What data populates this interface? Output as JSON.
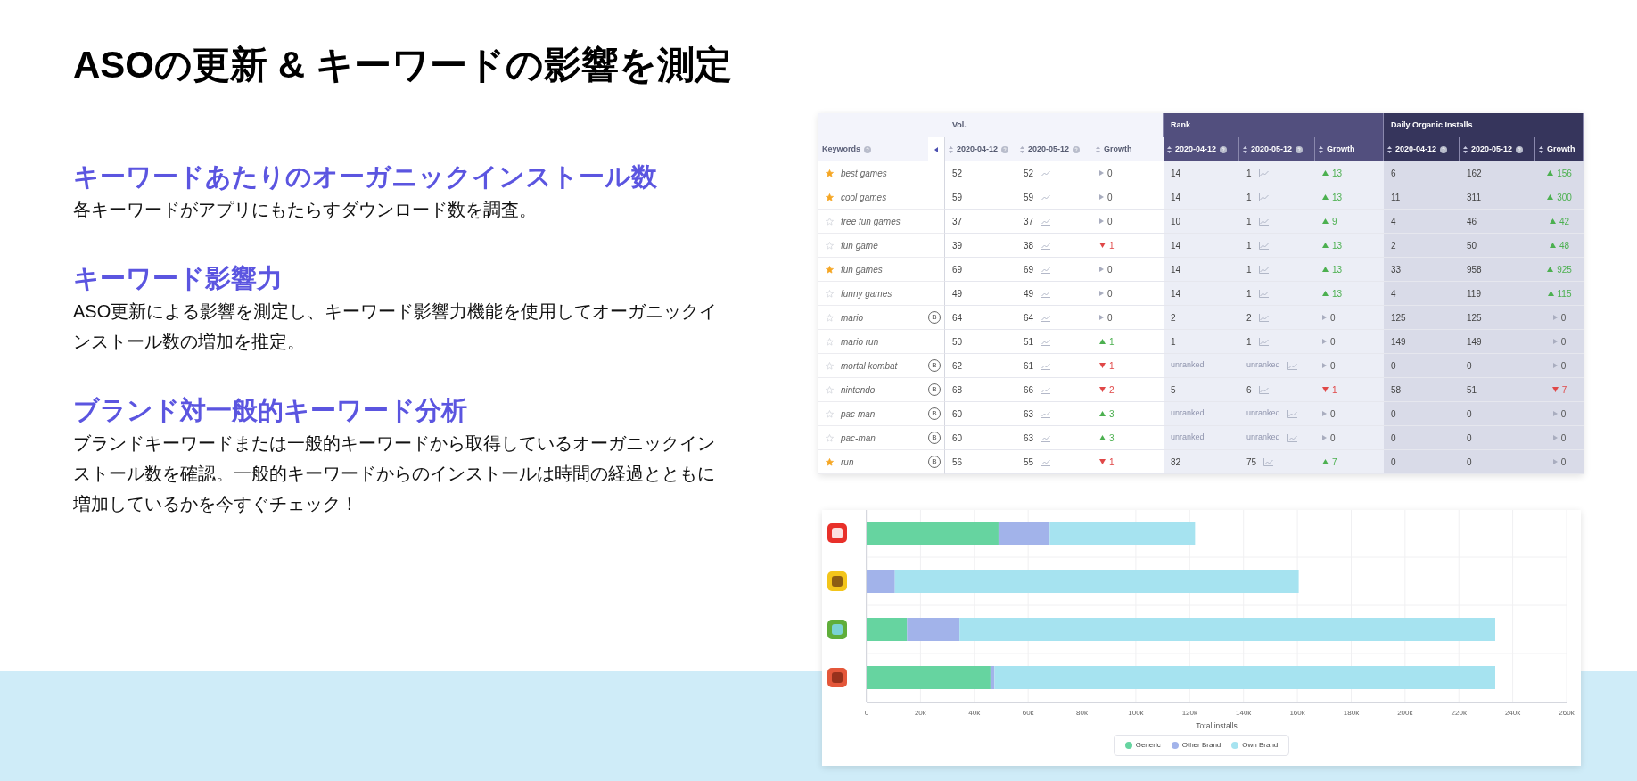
{
  "heading": "ASOの更新 & キーワードの影響を測定",
  "features": [
    {
      "title": "キーワードあたりのオーガニックインストール数",
      "text": "各キーワードがアプリにもたらすダウンロード数を調査。"
    },
    {
      "title": "キーワード影響力",
      "text": "ASO更新による影響を測定し、キーワード影響力機能を使用してオーガニックインストール数の増加を推定。"
    },
    {
      "title": "ブランド対一般的キーワード分析",
      "text": "ブランドキーワードまたは一般的キーワードから取得しているオーガニックインストール数を確認。一般的キーワードからのインストールは時間の経過とともに増加しているかを今すぐチェック！"
    }
  ],
  "table": {
    "keywords_header": "Keywords",
    "groups": [
      "Vol.",
      "Rank",
      "Daily Organic Installs"
    ],
    "columns": [
      "2020-04-12",
      "2020-05-12",
      "Growth",
      "2020-04-12",
      "2020-05-12",
      "Growth",
      "2020-04-12",
      "2020-05-12",
      "Growth"
    ],
    "rows": [
      {
        "keyword": "best games",
        "starred": true,
        "vol": [
          "52",
          "52"
        ],
        "vol_growth": {
          "kind": "flat",
          "value": "0"
        },
        "rank": [
          {
            "text": "14",
            "muted": false
          },
          {
            "text": "1",
            "muted": false
          }
        ],
        "rank_growth": {
          "kind": "up",
          "value": "13"
        },
        "installs": [
          "6",
          "162"
        ],
        "installs_growth": {
          "kind": "up",
          "value": "156"
        }
      },
      {
        "keyword": "cool games",
        "starred": true,
        "vol": [
          "59",
          "59"
        ],
        "vol_growth": {
          "kind": "flat",
          "value": "0"
        },
        "rank": [
          {
            "text": "14",
            "muted": false
          },
          {
            "text": "1",
            "muted": false
          }
        ],
        "rank_growth": {
          "kind": "up",
          "value": "13"
        },
        "installs": [
          "11",
          "311"
        ],
        "installs_growth": {
          "kind": "up",
          "value": "300"
        }
      },
      {
        "keyword": "free fun games",
        "starred": false,
        "vol": [
          "37",
          "37"
        ],
        "vol_growth": {
          "kind": "flat",
          "value": "0"
        },
        "rank": [
          {
            "text": "10",
            "muted": false
          },
          {
            "text": "1",
            "muted": false
          }
        ],
        "rank_growth": {
          "kind": "up",
          "value": "9"
        },
        "installs": [
          "4",
          "46"
        ],
        "installs_growth": {
          "kind": "up",
          "value": "42"
        }
      },
      {
        "keyword": "fun game",
        "starred": false,
        "vol": [
          "39",
          "38"
        ],
        "vol_growth": {
          "kind": "down",
          "value": "1"
        },
        "rank": [
          {
            "text": "14",
            "muted": false
          },
          {
            "text": "1",
            "muted": false
          }
        ],
        "rank_growth": {
          "kind": "up",
          "value": "13"
        },
        "installs": [
          "2",
          "50"
        ],
        "installs_growth": {
          "kind": "up",
          "value": "48"
        }
      },
      {
        "keyword": "fun games",
        "starred": true,
        "vol": [
          "69",
          "69"
        ],
        "vol_growth": {
          "kind": "flat",
          "value": "0"
        },
        "rank": [
          {
            "text": "14",
            "muted": false
          },
          {
            "text": "1",
            "muted": false
          }
        ],
        "rank_growth": {
          "kind": "up",
          "value": "13"
        },
        "installs": [
          "33",
          "958"
        ],
        "installs_growth": {
          "kind": "up",
          "value": "925"
        }
      },
      {
        "keyword": "funny games",
        "starred": false,
        "vol": [
          "49",
          "49"
        ],
        "vol_growth": {
          "kind": "flat",
          "value": "0"
        },
        "rank": [
          {
            "text": "14",
            "muted": false
          },
          {
            "text": "1",
            "muted": false
          }
        ],
        "rank_growth": {
          "kind": "up",
          "value": "13"
        },
        "installs": [
          "4",
          "119"
        ],
        "installs_growth": {
          "kind": "up",
          "value": "115"
        }
      },
      {
        "keyword": "mario",
        "starred": false,
        "brand": "B",
        "vol": [
          "64",
          "64"
        ],
        "vol_growth": {
          "kind": "flat",
          "value": "0"
        },
        "rank": [
          {
            "text": "2",
            "muted": false
          },
          {
            "text": "2",
            "muted": false
          }
        ],
        "rank_growth": {
          "kind": "flat",
          "value": "0"
        },
        "installs": [
          "125",
          "125"
        ],
        "installs_growth": {
          "kind": "flat",
          "value": "0"
        }
      },
      {
        "keyword": "mario run",
        "starred": false,
        "vol": [
          "50",
          "51"
        ],
        "vol_growth": {
          "kind": "up",
          "value": "1"
        },
        "rank": [
          {
            "text": "1",
            "muted": false
          },
          {
            "text": "1",
            "muted": false
          }
        ],
        "rank_growth": {
          "kind": "flat",
          "value": "0"
        },
        "installs": [
          "149",
          "149"
        ],
        "installs_growth": {
          "kind": "flat",
          "value": "0"
        }
      },
      {
        "keyword": "mortal kombat",
        "starred": false,
        "brand": "B",
        "vol": [
          "62",
          "61"
        ],
        "vol_growth": {
          "kind": "down",
          "value": "1"
        },
        "rank": [
          {
            "text": "unranked",
            "muted": true
          },
          {
            "text": "unranked",
            "muted": true
          }
        ],
        "rank_growth": {
          "kind": "flat",
          "value": "0"
        },
        "installs": [
          "0",
          "0"
        ],
        "installs_growth": {
          "kind": "flat",
          "value": "0"
        }
      },
      {
        "keyword": "nintendo",
        "starred": false,
        "brand": "B",
        "vol": [
          "68",
          "66"
        ],
        "vol_growth": {
          "kind": "down",
          "value": "2"
        },
        "rank": [
          {
            "text": "5",
            "muted": false
          },
          {
            "text": "6",
            "muted": false
          }
        ],
        "rank_growth": {
          "kind": "down",
          "value": "1"
        },
        "installs": [
          "58",
          "51"
        ],
        "installs_growth": {
          "kind": "down",
          "value": "7"
        }
      },
      {
        "keyword": "pac man",
        "starred": false,
        "brand": "B",
        "vol": [
          "60",
          "63"
        ],
        "vol_growth": {
          "kind": "up",
          "value": "3"
        },
        "rank": [
          {
            "text": "unranked",
            "muted": true
          },
          {
            "text": "unranked",
            "muted": true
          }
        ],
        "rank_growth": {
          "kind": "flat",
          "value": "0"
        },
        "installs": [
          "0",
          "0"
        ],
        "installs_growth": {
          "kind": "flat",
          "value": "0"
        }
      },
      {
        "keyword": "pac-man",
        "starred": false,
        "brand": "B",
        "vol": [
          "60",
          "63"
        ],
        "vol_growth": {
          "kind": "up",
          "value": "3"
        },
        "rank": [
          {
            "text": "unranked",
            "muted": true
          },
          {
            "text": "unranked",
            "muted": true
          }
        ],
        "rank_growth": {
          "kind": "flat",
          "value": "0"
        },
        "installs": [
          "0",
          "0"
        ],
        "installs_growth": {
          "kind": "flat",
          "value": "0"
        }
      },
      {
        "keyword": "run",
        "starred": true,
        "brand": "B",
        "vol": [
          "56",
          "55"
        ],
        "vol_growth": {
          "kind": "down",
          "value": "1"
        },
        "rank": [
          {
            "text": "82",
            "muted": false
          },
          {
            "text": "75",
            "muted": false
          }
        ],
        "rank_growth": {
          "kind": "up",
          "value": "7"
        },
        "installs": [
          "0",
          "0"
        ],
        "installs_growth": {
          "kind": "flat",
          "value": "0"
        }
      }
    ]
  },
  "chart": {
    "chart_data": {
      "type": "bar",
      "orientation": "horizontal",
      "stacked": true,
      "grid": true,
      "xlabel": "Total installs",
      "xlim": [
        0,
        260000
      ],
      "xticks": [
        {
          "value": 0,
          "label": "0"
        },
        {
          "value": 20000,
          "label": "20k"
        },
        {
          "value": 40000,
          "label": "40k"
        },
        {
          "value": 60000,
          "label": "60k"
        },
        {
          "value": 80000,
          "label": "80k"
        },
        {
          "value": 100000,
          "label": "100k"
        },
        {
          "value": 120000,
          "label": "120k"
        },
        {
          "value": 140000,
          "label": "140k"
        },
        {
          "value": 160000,
          "label": "160k"
        },
        {
          "value": 180000,
          "label": "180k"
        },
        {
          "value": 200000,
          "label": "200k"
        },
        {
          "value": 220000,
          "label": "220k"
        },
        {
          "value": 240000,
          "label": "240k"
        },
        {
          "value": 260000,
          "label": "260k"
        }
      ],
      "series": [
        {
          "name": "Generic",
          "color": "#66d4a0",
          "values": [
            49000,
            0,
            15000,
            46000
          ]
        },
        {
          "name": "Other Brand",
          "color": "#a2b3ea",
          "values": [
            19000,
            10500,
            19500,
            1500
          ]
        },
        {
          "name": "Own Brand",
          "color": "#a6e3f0",
          "values": [
            54000,
            150000,
            199000,
            186000
          ]
        }
      ]
    }
  }
}
